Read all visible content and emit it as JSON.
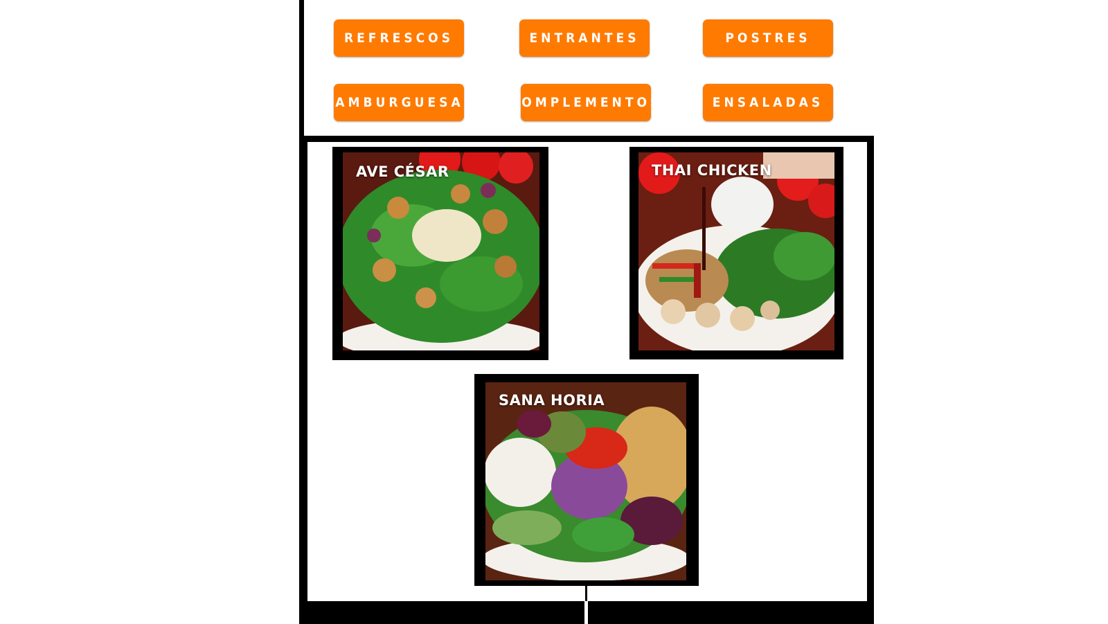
{
  "categories": {
    "refrescos": "REFRESCOS",
    "entrantes": "ENTRANTES",
    "postres": "POSTRES",
    "hamburguesas": "HAMBURGUESAS",
    "complementos": "COMPLEMENTOS",
    "ensaladas": "ENSALADAS"
  },
  "products": {
    "ave_cesar": "AVE CÉSAR",
    "thai_chicken": "THAI CHICKEN",
    "sana_horia": "SANA HORIA"
  },
  "colors": {
    "button": "#ff7a00",
    "button_text": "#ffffff",
    "frame": "#000000"
  }
}
